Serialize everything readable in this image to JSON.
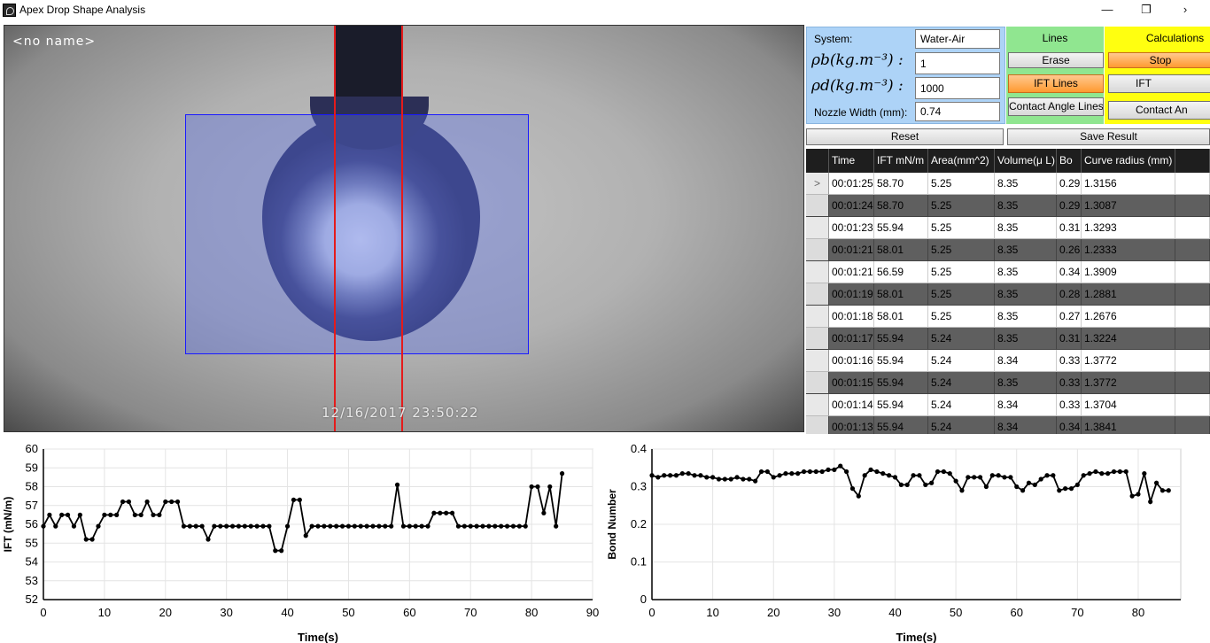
{
  "window": {
    "title": "Apex Drop Shape Analysis"
  },
  "camera": {
    "label": "<no name>",
    "timestamp": "12/16/2017   23:50:22"
  },
  "system": {
    "system_label": "System:",
    "system_value": "Water-Air",
    "rho_b_label": "ρb(kg.m⁻³) :",
    "rho_b_value": "1",
    "rho_d_label": "ρd(kg.m⁻³) :",
    "rho_d_value": "1000",
    "nozzle_label": "Nozzle Width (mm):",
    "nozzle_value": "0.74"
  },
  "lines": {
    "title": "Lines",
    "erase": "Erase",
    "ift_lines": "IFT Lines",
    "contact_angle_lines": "Contact Angle Lines"
  },
  "calculations": {
    "title": "Calculations",
    "stop": "Stop",
    "ift": "IFT",
    "contact_angle": "Contact An"
  },
  "actions": {
    "reset": "Reset",
    "save": "Save Result"
  },
  "table": {
    "row_marker": ">",
    "columns": [
      "Time",
      "IFT mN/m",
      "Area(mm^2)",
      "Volume(μ L)",
      "Bo",
      "Curve radius (mm)"
    ],
    "rows": [
      [
        "00:01:25",
        "58.70",
        "5.25",
        "8.35",
        "0.29",
        "1.3156"
      ],
      [
        "00:01:24",
        "58.70",
        "5.25",
        "8.35",
        "0.29",
        "1.3087"
      ],
      [
        "00:01:23",
        "55.94",
        "5.25",
        "8.35",
        "0.31",
        "1.3293"
      ],
      [
        "00:01:21",
        "58.01",
        "5.25",
        "8.35",
        "0.26",
        "1.2333"
      ],
      [
        "00:01:21",
        "56.59",
        "5.25",
        "8.35",
        "0.34",
        "1.3909"
      ],
      [
        "00:01:19",
        "58.01",
        "5.25",
        "8.35",
        "0.28",
        "1.2881"
      ],
      [
        "00:01:18",
        "58.01",
        "5.25",
        "8.35",
        "0.27",
        "1.2676"
      ],
      [
        "00:01:17",
        "55.94",
        "5.24",
        "8.35",
        "0.31",
        "1.3224"
      ],
      [
        "00:01:16",
        "55.94",
        "5.24",
        "8.34",
        "0.33",
        "1.3772"
      ],
      [
        "00:01:15",
        "55.94",
        "5.24",
        "8.35",
        "0.33",
        "1.3772"
      ],
      [
        "00:01:14",
        "55.94",
        "5.24",
        "8.34",
        "0.33",
        "1.3704"
      ],
      [
        "00:01:13",
        "55.94",
        "5.24",
        "8.34",
        "0.34",
        "1.3841"
      ]
    ]
  },
  "chart_data": [
    {
      "type": "line",
      "xlabel": "Time(s)",
      "ylabel": "IFT (mN/m)",
      "xlim": [
        0,
        90
      ],
      "ylim": [
        52,
        60
      ],
      "grid": true,
      "xticks": [
        "0",
        "10",
        "20",
        "30",
        "40",
        "50",
        "60",
        "70",
        "80",
        "90"
      ],
      "yticks": [
        "52",
        "53",
        "54",
        "55",
        "56",
        "57",
        "58",
        "59",
        "60"
      ],
      "x": [
        0,
        1,
        2,
        3,
        4,
        5,
        6,
        7,
        8,
        9,
        10,
        11,
        12,
        13,
        14,
        15,
        16,
        17,
        18,
        19,
        20,
        21,
        22,
        23,
        24,
        25,
        26,
        27,
        28,
        29,
        30,
        31,
        32,
        33,
        34,
        35,
        36,
        37,
        38,
        39,
        40,
        41,
        42,
        43,
        44,
        45,
        46,
        47,
        48,
        49,
        50,
        51,
        52,
        53,
        54,
        55,
        56,
        57,
        58,
        59,
        60,
        61,
        62,
        63,
        64,
        65,
        66,
        67,
        68,
        69,
        70,
        71,
        72,
        73,
        74,
        75,
        76,
        77,
        78,
        79,
        80,
        81,
        82,
        83,
        84,
        85
      ],
      "y": [
        55.9,
        56.5,
        55.9,
        56.5,
        56.5,
        55.9,
        56.5,
        55.2,
        55.2,
        55.9,
        56.5,
        56.5,
        56.5,
        57.2,
        57.2,
        56.5,
        56.5,
        57.2,
        56.5,
        56.5,
        57.2,
        57.2,
        57.2,
        55.9,
        55.9,
        55.9,
        55.9,
        55.2,
        55.9,
        55.9,
        55.9,
        55.9,
        55.9,
        55.9,
        55.9,
        55.9,
        55.9,
        55.9,
        54.6,
        54.6,
        55.9,
        57.3,
        57.3,
        55.4,
        55.9,
        55.9,
        55.9,
        55.9,
        55.9,
        55.9,
        55.9,
        55.9,
        55.9,
        55.9,
        55.9,
        55.9,
        55.9,
        55.9,
        58.1,
        55.9,
        55.9,
        55.9,
        55.9,
        55.9,
        56.6,
        56.6,
        56.6,
        56.6,
        55.9,
        55.9,
        55.9,
        55.9,
        55.9,
        55.9,
        55.9,
        55.9,
        55.9,
        55.9,
        55.9,
        55.9,
        58.0,
        58.0,
        56.6,
        58.0,
        55.9,
        58.7
      ]
    },
    {
      "type": "line",
      "xlabel": "Time(s)",
      "ylabel": "Bond Number",
      "xlim": [
        0,
        87
      ],
      "ylim": [
        0,
        0.4
      ],
      "grid": true,
      "xticks": [
        "0",
        "10",
        "20",
        "30",
        "40",
        "50",
        "60",
        "70",
        "80"
      ],
      "yticks": [
        "0",
        "0.1",
        "0.2",
        "0.3",
        "0.4"
      ],
      "x": [
        0,
        1,
        2,
        3,
        4,
        5,
        6,
        7,
        8,
        9,
        10,
        11,
        12,
        13,
        14,
        15,
        16,
        17,
        18,
        19,
        20,
        21,
        22,
        23,
        24,
        25,
        26,
        27,
        28,
        29,
        30,
        31,
        32,
        33,
        34,
        35,
        36,
        37,
        38,
        39,
        40,
        41,
        42,
        43,
        44,
        45,
        46,
        47,
        48,
        49,
        50,
        51,
        52,
        53,
        54,
        55,
        56,
        57,
        58,
        59,
        60,
        61,
        62,
        63,
        64,
        65,
        66,
        67,
        68,
        69,
        70,
        71,
        72,
        73,
        74,
        75,
        76,
        77,
        78,
        79,
        80,
        81,
        82,
        83,
        84,
        85
      ],
      "y": [
        0.33,
        0.325,
        0.33,
        0.33,
        0.33,
        0.335,
        0.335,
        0.33,
        0.33,
        0.325,
        0.325,
        0.32,
        0.32,
        0.32,
        0.325,
        0.32,
        0.32,
        0.315,
        0.34,
        0.34,
        0.325,
        0.33,
        0.335,
        0.335,
        0.335,
        0.34,
        0.34,
        0.34,
        0.34,
        0.345,
        0.345,
        0.355,
        0.34,
        0.295,
        0.275,
        0.33,
        0.345,
        0.34,
        0.335,
        0.33,
        0.325,
        0.305,
        0.305,
        0.33,
        0.33,
        0.305,
        0.31,
        0.34,
        0.34,
        0.335,
        0.315,
        0.29,
        0.325,
        0.325,
        0.325,
        0.3,
        0.33,
        0.33,
        0.325,
        0.325,
        0.3,
        0.29,
        0.31,
        0.305,
        0.32,
        0.33,
        0.33,
        0.29,
        0.295,
        0.295,
        0.305,
        0.33,
        0.335,
        0.34,
        0.335,
        0.335,
        0.34,
        0.34,
        0.34,
        0.275,
        0.28,
        0.335,
        0.26,
        0.31,
        0.29,
        0.29
      ]
    }
  ]
}
